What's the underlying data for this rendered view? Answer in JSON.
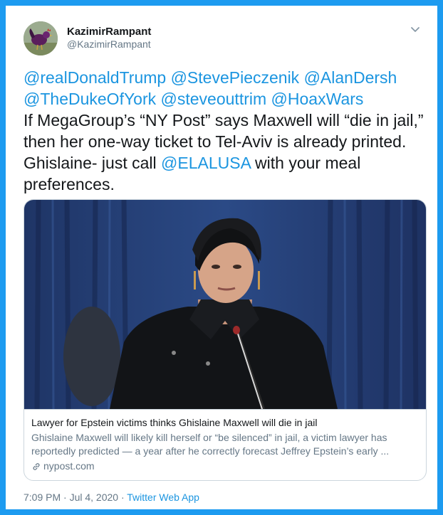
{
  "author": {
    "name": "KazimirRampant",
    "handle": "@KazimirRampant",
    "avatar_icon": "rooster-avatar-icon"
  },
  "tweet": {
    "lines": [
      [
        {
          "text": "@realDonaldTrump",
          "mention": true
        },
        {
          "text": " ",
          "mention": false
        },
        {
          "text": "@StevePieczenik",
          "mention": true
        },
        {
          "text": " ",
          "mention": false
        },
        {
          "text": "@AlanDersh",
          "mention": true
        }
      ],
      [
        {
          "text": "@TheDukeOfYork",
          "mention": true
        },
        {
          "text": " ",
          "mention": false
        },
        {
          "text": "@steveouttrim",
          "mention": true
        },
        {
          "text": " ",
          "mention": false
        },
        {
          "text": "@HoaxWars",
          "mention": true
        }
      ],
      [
        {
          "text": "If MegaGroup’s “NY Post” says Maxwell will “die in jail,”",
          "mention": false
        }
      ],
      [
        {
          "text": "then her one-way ticket to Tel-Aviv is already printed.",
          "mention": false
        }
      ],
      [
        {
          "text": "Ghislaine- just call ",
          "mention": false
        },
        {
          "text": "@ELALUSA",
          "mention": true
        },
        {
          "text": " with your meal",
          "mention": false
        }
      ],
      [
        {
          "text": "preferences.",
          "mention": false
        }
      ]
    ]
  },
  "card": {
    "title": "Lawyer for Epstein victims thinks Ghislaine Maxwell will die in jail",
    "description_lines": [
      "Ghislaine Maxwell will likely kill herself or “be silenced” in jail, a victim lawyer has",
      "reportedly predicted — a year after he correctly forecast Jeffrey Epstein’s early ..."
    ],
    "domain": "nypost.com"
  },
  "meta": {
    "timestamp": "7:09 PM · Jul 4, 2020 ·",
    "source": "Twitter Web App"
  },
  "colors": {
    "frame": "#1d9bf0",
    "link": "#1b95e0",
    "text": "#14171a",
    "secondary": "#657786"
  }
}
